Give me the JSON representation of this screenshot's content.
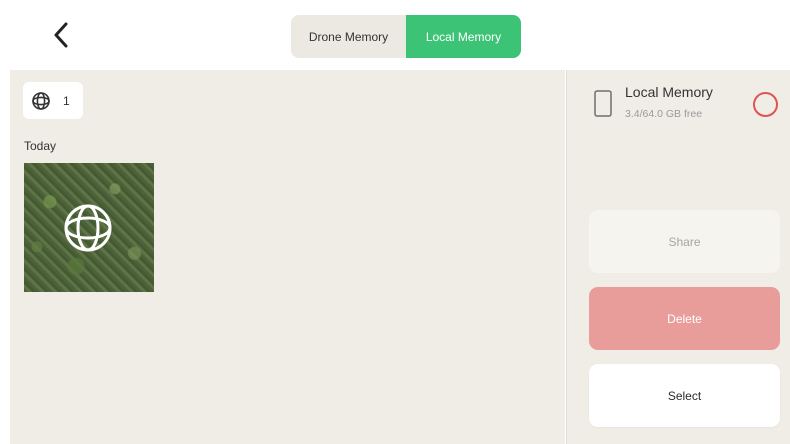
{
  "header": {
    "back_icon": "chevron-left-icon",
    "segments": [
      {
        "label": "Drone Memory",
        "active": false
      },
      {
        "label": "Local Memory",
        "active": true
      }
    ]
  },
  "gallery": {
    "filter_icon": "panorama-sphere-icon",
    "filter_count": "1",
    "groups": [
      {
        "date": "Today",
        "items": [
          {
            "type": "panorama",
            "icon": "panorama-sphere-icon"
          }
        ]
      }
    ]
  },
  "sidebar": {
    "storage": {
      "icon": "phone-icon",
      "title": "Local Memory",
      "free_text": "3.4/64.0 GB free"
    },
    "buttons": {
      "share": "Share",
      "delete": "Delete",
      "select": "Select"
    }
  },
  "colors": {
    "accent": "#3cc376",
    "delete": "#e89d9a",
    "select_circle": "#e05353",
    "panel_bg": "#f0ede6"
  }
}
